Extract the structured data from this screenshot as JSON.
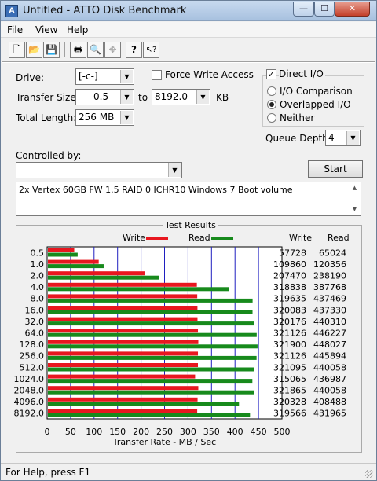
{
  "window": {
    "title": "Untitled - ATTO Disk Benchmark",
    "app_icon_text": "A",
    "controls": {
      "minimize": "—",
      "maximize": "☐",
      "close": "✕"
    }
  },
  "menu": [
    "File",
    "View",
    "Help"
  ],
  "toolbar_icons": [
    "new-document-icon",
    "open-folder-icon",
    "save-icon",
    "print-icon",
    "print-preview-icon",
    "move-icon",
    "help-icon",
    "context-help-icon"
  ],
  "toolbar_glyphs": [
    "🗋",
    "📂",
    "💾",
    "🖶",
    "🔍",
    "✥",
    "?",
    "↖?"
  ],
  "drive": {
    "label": "Drive:",
    "value": "[-c-]"
  },
  "transfer_size": {
    "label": "Transfer Size:",
    "from": "0.5",
    "to_label": "to",
    "to": "8192.0",
    "unit": "KB"
  },
  "total_length": {
    "label": "Total Length:",
    "value": "256 MB"
  },
  "force_write": {
    "label": "Force Write Access",
    "checked": false
  },
  "direct_io": {
    "label": "Direct I/O",
    "checked": true
  },
  "io_mode": {
    "options": [
      "I/O Comparison",
      "Overlapped I/O",
      "Neither"
    ],
    "selected": 1
  },
  "queue_depth": {
    "label": "Queue Depth:",
    "value": "4"
  },
  "controlled_by": {
    "label": "Controlled by:",
    "value": ""
  },
  "start_button": "Start",
  "description": "2x Vertex 60GB FW 1.5 RAID 0 ICHR10 Windows 7 Boot volume",
  "results": {
    "title": "Test Results",
    "legend_write": "Write",
    "legend_read": "Read",
    "col_write": "Write",
    "col_read": "Read",
    "write_color": "#e8171f",
    "read_color": "#178a1c"
  },
  "chart_data": {
    "type": "bar",
    "orientation": "horizontal",
    "xlabel": "Transfer Rate - MB / Sec",
    "xlim": [
      0,
      500
    ],
    "xticks": [
      0,
      50,
      100,
      150,
      200,
      250,
      300,
      350,
      400,
      450,
      500
    ],
    "categories": [
      "0.5",
      "1.0",
      "2.0",
      "4.0",
      "8.0",
      "16.0",
      "32.0",
      "64.0",
      "128.0",
      "256.0",
      "512.0",
      "1024.0",
      "2048.0",
      "4096.0",
      "8192.0"
    ],
    "series": [
      {
        "name": "Write",
        "values": [
          57728,
          109860,
          207470,
          318838,
          319635,
          320083,
          320176,
          321126,
          321900,
          321126,
          321095,
          315065,
          321865,
          320328,
          319566
        ]
      },
      {
        "name": "Read",
        "values": [
          65024,
          120356,
          238190,
          387768,
          437469,
          437330,
          440310,
          446227,
          448027,
          445894,
          440058,
          436987,
          440058,
          408488,
          431965
        ]
      }
    ]
  },
  "status": "For Help, press F1"
}
